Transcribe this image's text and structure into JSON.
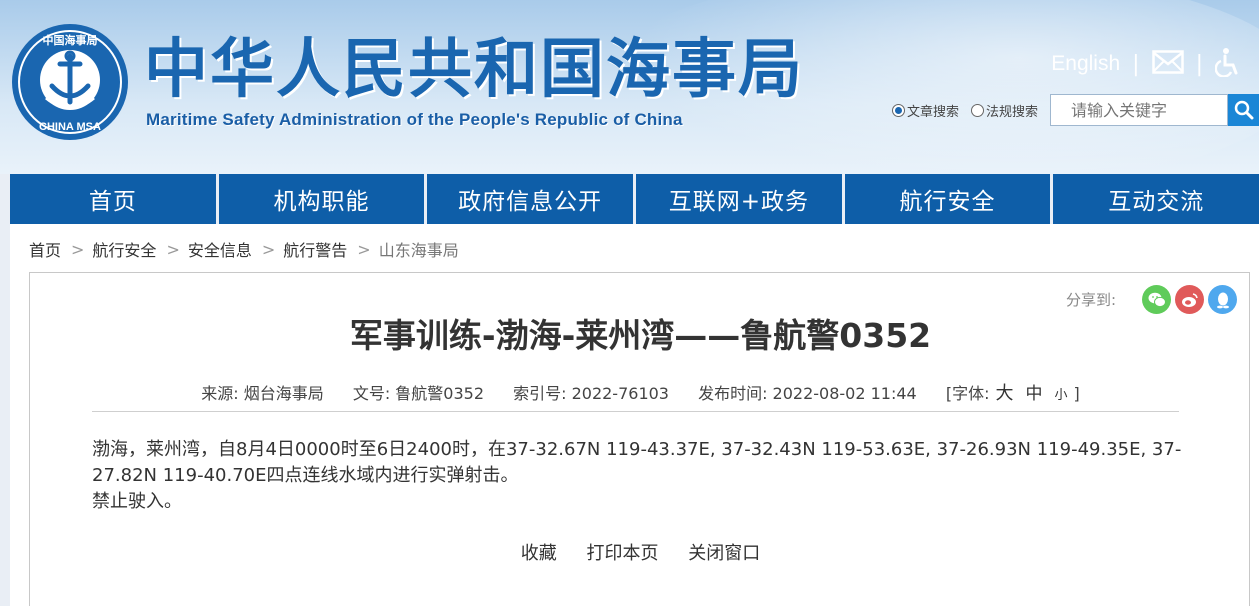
{
  "header": {
    "title_cn": "中华人民共和国海事局",
    "title_en": "Maritime Safety Administration of the People's Republic of China",
    "logo_text_top": "中国海事局",
    "logo_text_bottom": "CHINA MSA",
    "lang_link": "English",
    "icons": [
      "mail-icon",
      "accessibility-icon"
    ],
    "search": {
      "option_article": "文章搜索",
      "option_law": "法规搜索",
      "selected": "文章搜索",
      "placeholder": "请输入关键字"
    }
  },
  "nav": {
    "items": [
      "首页",
      "机构职能",
      "政府信息公开",
      "互联网+政务",
      "航行安全",
      "互动交流"
    ]
  },
  "breadcrumb": {
    "items": [
      "首页",
      "航行安全",
      "安全信息",
      "航行警告",
      "山东海事局"
    ],
    "separator": ">"
  },
  "article": {
    "share_label": "分享到:",
    "share_icons": [
      "wechat-icon",
      "weibo-icon",
      "qq-icon"
    ],
    "title": "军事训练-渤海-莱州湾——鲁航警0352",
    "meta": {
      "source": "来源:  烟台海事局",
      "doc_no": "文号:  鲁航警0352",
      "index_no": "索引号:  2022-76103",
      "publish_time": "发布时间:  2022-08-02 11:44",
      "font_label": "[字体:",
      "font_large": "大",
      "font_medium": "中",
      "font_small": "小",
      "font_close": "]"
    },
    "body_line1": "渤海，莱州湾，自8月4日0000时至6日2400时，在37-32.67N 119-43.37E, 37-32.43N 119-53.63E, 37-26.93N 119-49.35E, 37-27.82N  119-40.70E四点连线水域内进行实弹射击。",
    "body_line2": "禁止驶入。",
    "actions": {
      "favorite": "收藏",
      "print": "打印本页",
      "close": "关闭窗口"
    }
  },
  "colors": {
    "nav_bg": "#0e5ea8",
    "title_blue": "#1a66b0",
    "wechat": "#5fcb5a",
    "weibo": "#e05a5a",
    "qq": "#4fa8ee"
  }
}
